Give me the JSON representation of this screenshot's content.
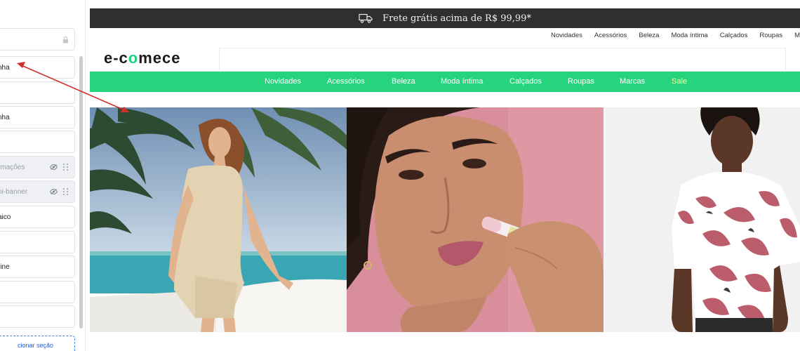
{
  "editor": {
    "sections": [
      {
        "label": "",
        "hidden": false,
        "locked": true
      },
      {
        "label": "nha",
        "hidden": false
      },
      {
        "label": "",
        "hidden": false
      },
      {
        "label": "nha",
        "hidden": false
      },
      {
        "label": "",
        "hidden": false
      },
      {
        "label": "rmações",
        "hidden": true
      },
      {
        "label": "ni-banner",
        "hidden": true
      },
      {
        "label": "aico",
        "hidden": false
      },
      {
        "label": "",
        "hidden": false
      },
      {
        "label": "rine",
        "hidden": false
      },
      {
        "label": "",
        "hidden": false
      },
      {
        "label": "",
        "hidden": false
      }
    ],
    "add_section_label": "cionar seção"
  },
  "store": {
    "promo_text": "Frete grátis acima de R$ 99,99*",
    "top_links": [
      "Novidades",
      "Acessórios",
      "Beleza",
      "Moda íntima",
      "Calçados",
      "Roupas",
      "M"
    ],
    "logo_prefix": "e-c",
    "logo_accent": "o",
    "logo_suffix": "mece",
    "nav": [
      "Novidades",
      "Acessórios",
      "Beleza",
      "Moda íntima",
      "Calçados",
      "Roupas",
      "Marcas",
      "Sale"
    ],
    "banners": [
      "beach-fashion-banner",
      "beauty-lipstick-banner",
      "menswear-shirt-banner"
    ]
  },
  "colors": {
    "accent_green": "#27d47e",
    "promo_bar": "#2f2f31",
    "annotation_arrow": "#d32f2f",
    "add_section_border": "#3b82f6"
  }
}
